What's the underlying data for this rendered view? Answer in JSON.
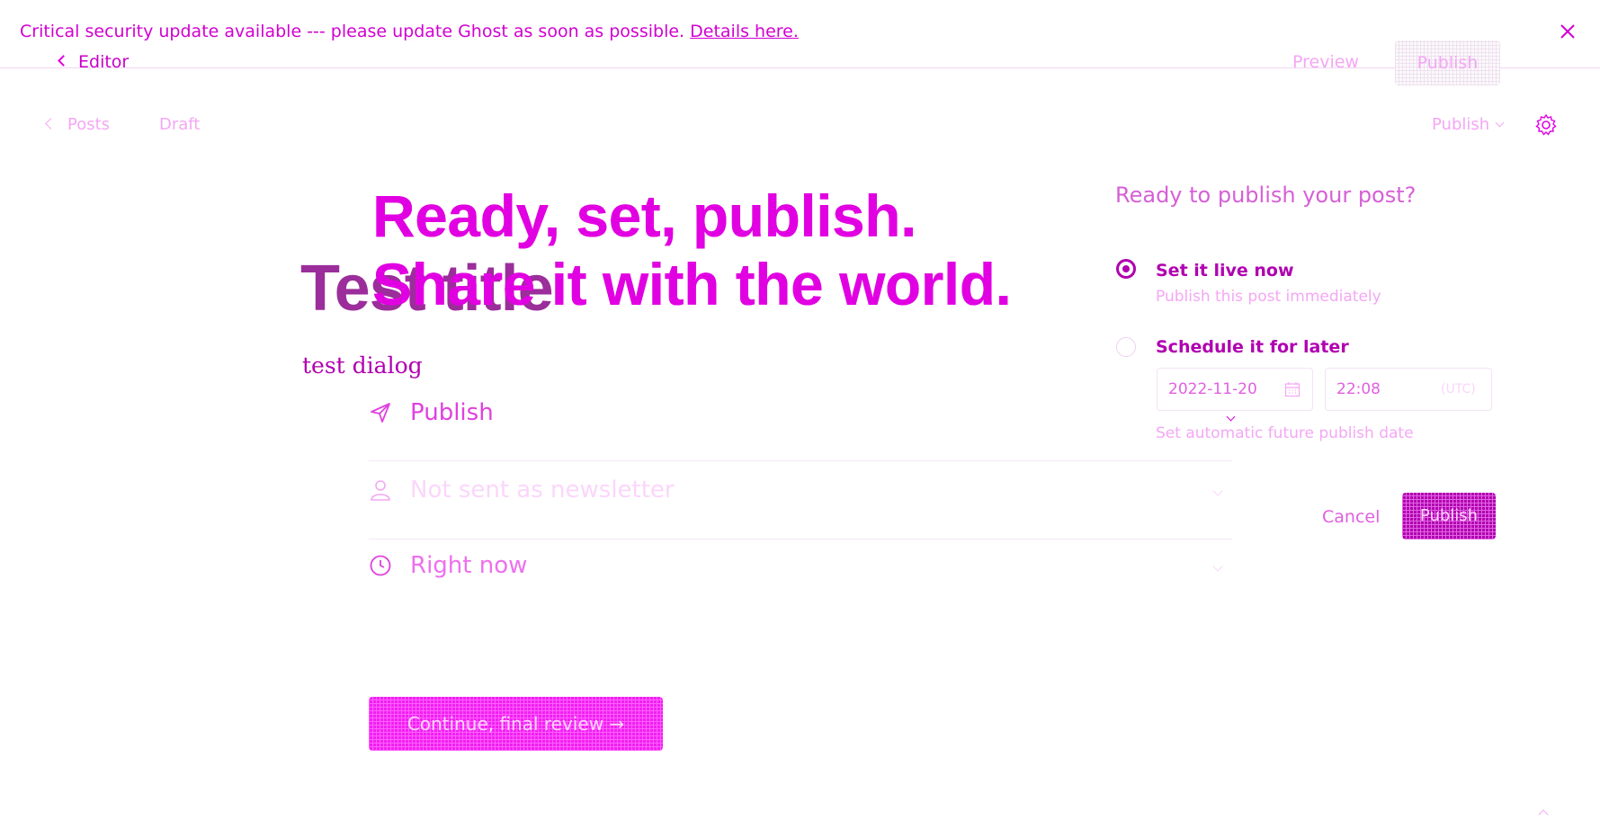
{
  "banner": {
    "message": "Critical security update available --- please update Ghost as soon as possible.",
    "link": "Details here."
  },
  "overlay": {
    "back_label": "Editor",
    "preview_label": "Preview",
    "publish_label": "Publish"
  },
  "editor": {
    "breadcrumb": "Posts",
    "status": "Draft",
    "publish_menu": "Publish",
    "post_title": "Test title",
    "post_body": "test dialog"
  },
  "hero": {
    "line1": "Ready, set, publish.",
    "line2": "Share it with the world."
  },
  "options": [
    {
      "label": "Publish",
      "icon": "send-icon"
    },
    {
      "label": "Not sent as newsletter",
      "icon": "user-icon"
    },
    {
      "label": "Right now",
      "icon": "clock-icon"
    }
  ],
  "continue_label": "Continue, final review →",
  "popover": {
    "question": "Ready to publish your post?",
    "now_title": "Set it live now",
    "now_sub": "Publish this post immediately",
    "later_title": "Schedule it for later",
    "date": "2022-11-20",
    "time": "22:08",
    "timezone": "(UTC)",
    "later_sub": "Set automatic future publish date",
    "cancel": "Cancel",
    "publish": "Publish",
    "selected": "now"
  },
  "colors": {
    "accent": "#e100e1",
    "accent_dark": "#b000b0"
  }
}
